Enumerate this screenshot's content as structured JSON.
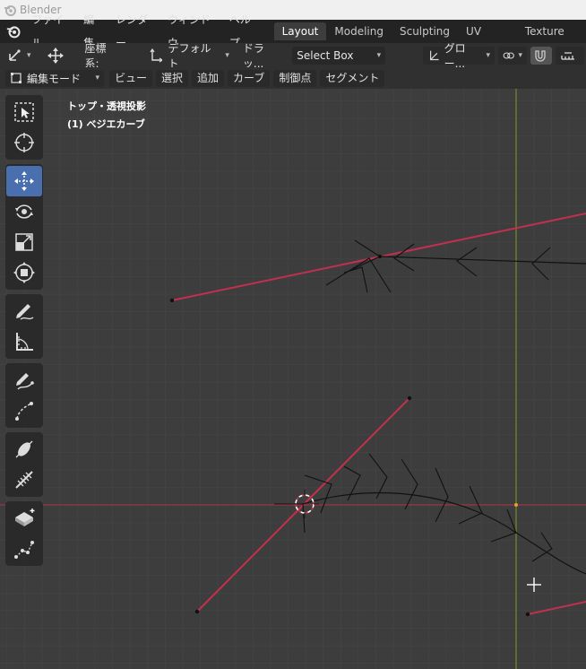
{
  "window": {
    "title": "Blender"
  },
  "menubar": {
    "items": [
      "ファイル",
      "編集",
      "レンダー",
      "ウィンドウ",
      "ヘルプ"
    ],
    "tabs": [
      "Layout",
      "Modeling",
      "Sculpting",
      "UV Editing",
      "Texture Paint"
    ],
    "active_tab": "Layout"
  },
  "header": {
    "orientation_label": "座標系:",
    "orientation_value": "デフォルト",
    "drag_label": "ドラッ...",
    "select_box": "Select Box",
    "transform_value": "グロー..."
  },
  "header2": {
    "mode": "編集モード",
    "menus": [
      "ビュー",
      "選択",
      "追加",
      "カーブ",
      "制御点",
      "セグメント"
    ]
  },
  "viewport": {
    "view_name": "トップ・透視投影",
    "object_name": "(1) ベジエカーブ"
  },
  "colors": {
    "background": "#3d3d3d",
    "grid": "#474747",
    "x_axis": "#9b3645",
    "y_axis": "#6e8f2e",
    "handle": "#c2304f",
    "active_tool": "#4a6fae"
  },
  "toolbar": {
    "tools": [
      "select-box-icon",
      "cursor-icon",
      "move-icon",
      "rotate-icon",
      "scale-icon",
      "transform-icon",
      "annotate-icon",
      "measure-icon",
      "draw-icon",
      "curve-pen-icon",
      "tilt-icon",
      "randomize-icon",
      "extrude-icon",
      "radius-icon"
    ],
    "active": "move-icon"
  }
}
